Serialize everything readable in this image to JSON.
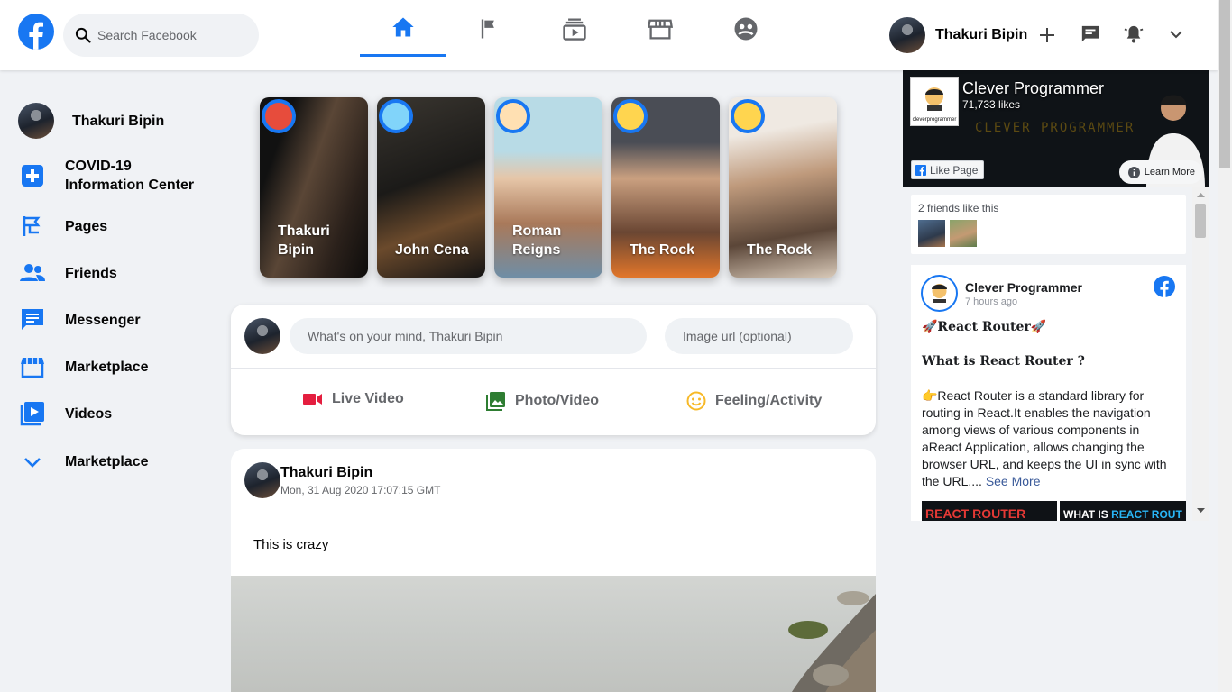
{
  "header": {
    "logo_icon": "facebook-logo-icon",
    "search_placeholder": "Search Facebook",
    "tabs": [
      "home-icon",
      "flag-icon",
      "watch-icon",
      "marketplace-icon",
      "groups-icon"
    ],
    "user_name": "Thakuri Bipin",
    "icons": [
      "plus-icon",
      "messenger-icon",
      "notifications-icon",
      "chevron-down-icon"
    ],
    "accent": "#1877f2"
  },
  "sidebar": {
    "user_name": "Thakuri Bipin",
    "items": [
      {
        "label": "COVID-19 Information Center",
        "icon": "covid-plus-icon"
      },
      {
        "label": "Pages",
        "icon": "pages-flag-icon"
      },
      {
        "label": "Friends",
        "icon": "friends-icon"
      },
      {
        "label": "Messenger",
        "icon": "messenger-icon"
      },
      {
        "label": "Marketplace",
        "icon": "marketplace-icon"
      },
      {
        "label": "Videos",
        "icon": "videos-icon"
      },
      {
        "label": "Marketplace",
        "icon": "chevron-down-icon"
      }
    ]
  },
  "stories": [
    {
      "name": "Thakuri Bipin"
    },
    {
      "name": "John Cena"
    },
    {
      "name": "Roman Reigns"
    },
    {
      "name": "The Rock"
    },
    {
      "name": "The Rock"
    }
  ],
  "composer": {
    "message_placeholder": "What's on your mind, Thakuri Bipin",
    "image_placeholder": "Image url (optional)",
    "options": [
      {
        "label": "Live Video",
        "icon": "live-video-icon",
        "color": "#e41e3f"
      },
      {
        "label": "Photo/Video",
        "icon": "photo-icon",
        "color": "#2e7d32"
      },
      {
        "label": "Feeling/Activity",
        "icon": "feeling-icon",
        "color": "#f7b928"
      }
    ]
  },
  "post": {
    "user_name": "Thakuri Bipin",
    "timestamp": "Mon, 31 Aug 2020 17:07:15 GMT",
    "message": "This is crazy"
  },
  "widget": {
    "page_name": "Clever Programmer",
    "likes": "71,733 likes",
    "logo_text": "cleverprogrammer",
    "cover_text": "CLEVER PROGRAMMER",
    "like_button": "Like Page",
    "learn_more": "Learn More",
    "friends_like": "2 friends like this",
    "post_page_name": "Clever Programmer",
    "post_time": "7 hours ago",
    "post_heading": "🚀React Router🚀",
    "post_subheading": "What is React Router ?",
    "post_body": "👉React Router is a standard library for routing in React.It enables the navigation among views of various components in aReact Application, allows changing the browser URL, and keeps the UI in sync with the URL....",
    "see_more": "See More",
    "thumb_1": "REACT ROUTER",
    "thumb_2_a": "WHAT IS ",
    "thumb_2_b": "REACT ROUT"
  }
}
